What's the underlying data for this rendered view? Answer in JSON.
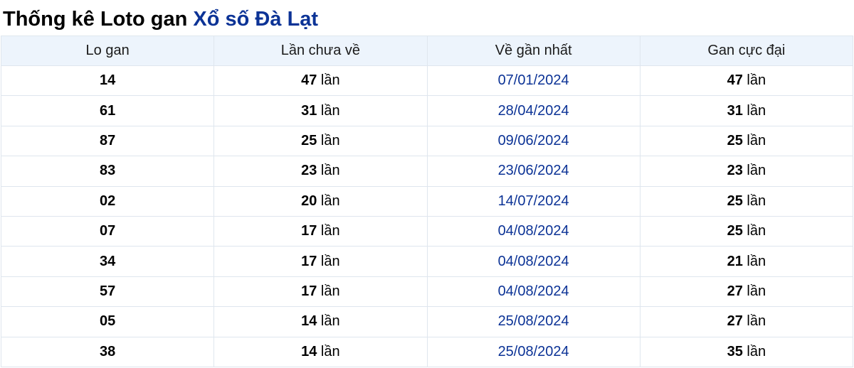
{
  "title": {
    "prefix": "Thống kê Loto gan",
    "link": "Xổ số Đà Lạt"
  },
  "table": {
    "headers": [
      "Lo gan",
      "Lần chưa về",
      "Về gần nhất",
      "Gan cực đại"
    ],
    "unit": "lần",
    "rows": [
      {
        "lo": "14",
        "chua_ve": "47",
        "gan_nhat": "07/01/2024",
        "cuc_dai": "47"
      },
      {
        "lo": "61",
        "chua_ve": "31",
        "gan_nhat": "28/04/2024",
        "cuc_dai": "31"
      },
      {
        "lo": "87",
        "chua_ve": "25",
        "gan_nhat": "09/06/2024",
        "cuc_dai": "25"
      },
      {
        "lo": "83",
        "chua_ve": "23",
        "gan_nhat": "23/06/2024",
        "cuc_dai": "23"
      },
      {
        "lo": "02",
        "chua_ve": "20",
        "gan_nhat": "14/07/2024",
        "cuc_dai": "25"
      },
      {
        "lo": "07",
        "chua_ve": "17",
        "gan_nhat": "04/08/2024",
        "cuc_dai": "25"
      },
      {
        "lo": "34",
        "chua_ve": "17",
        "gan_nhat": "04/08/2024",
        "cuc_dai": "21"
      },
      {
        "lo": "57",
        "chua_ve": "17",
        "gan_nhat": "04/08/2024",
        "cuc_dai": "27"
      },
      {
        "lo": "05",
        "chua_ve": "14",
        "gan_nhat": "25/08/2024",
        "cuc_dai": "27"
      },
      {
        "lo": "38",
        "chua_ve": "14",
        "gan_nhat": "25/08/2024",
        "cuc_dai": "35"
      }
    ]
  },
  "colors": {
    "link": "#0c3396",
    "header_bg": "#edf4fc",
    "border": "#dfe6ee"
  }
}
